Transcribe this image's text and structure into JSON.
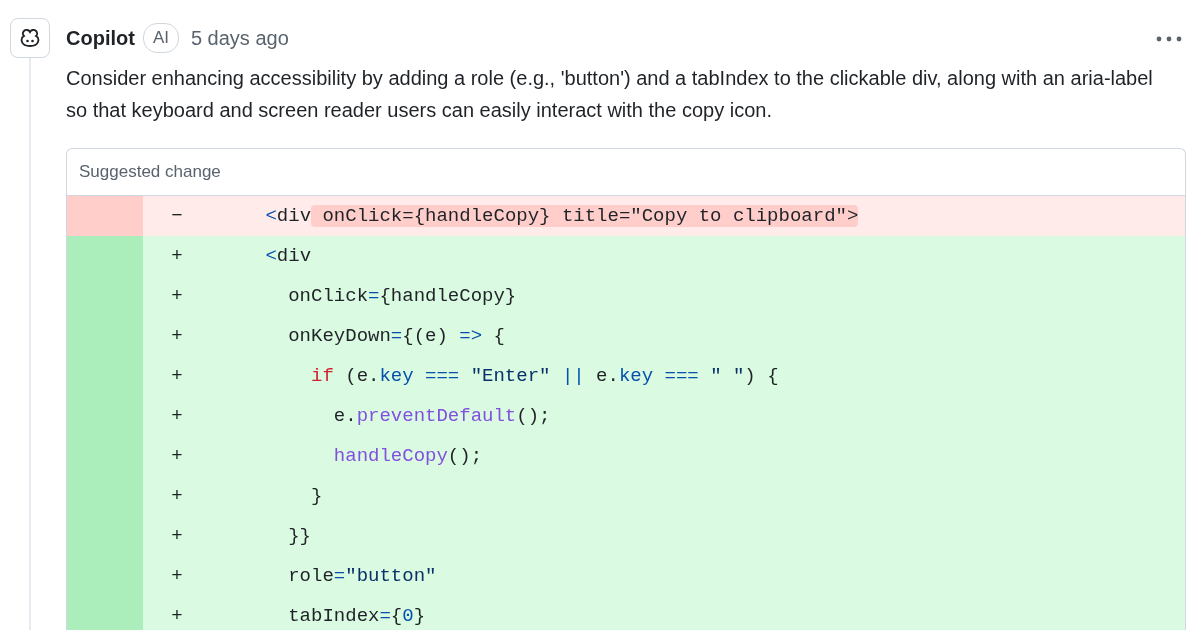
{
  "comment": {
    "author": "Copilot",
    "badge": "AI",
    "time": "5 days ago",
    "body": "Consider enhancing accessibility by adding a role (e.g., 'button') and a tabIndex to the clickable div, along with an aria-label so that keyboard and screen reader users can easily interact with the copy icon."
  },
  "suggestion": {
    "title": "Suggested change",
    "lines": [
      {
        "kind": "removed",
        "marker": "−",
        "tokens": [
          {
            "kind": "punct",
            "text": "      <"
          },
          {
            "kind": "plain",
            "text": "div"
          },
          {
            "kind": "changed",
            "text": " onClick={handleCopy} title=\"Copy to clipboard\">"
          }
        ]
      },
      {
        "kind": "added",
        "marker": "+",
        "tokens": [
          {
            "kind": "punct",
            "text": "      <"
          },
          {
            "kind": "plain",
            "text": "div"
          }
        ]
      },
      {
        "kind": "added",
        "marker": "+",
        "tokens": [
          {
            "kind": "plain",
            "text": "        onClick"
          },
          {
            "kind": "operator",
            "text": "="
          },
          {
            "kind": "plain",
            "text": "{handleCopy}"
          }
        ]
      },
      {
        "kind": "added",
        "marker": "+",
        "tokens": [
          {
            "kind": "plain",
            "text": "        onKeyDown"
          },
          {
            "kind": "operator",
            "text": "="
          },
          {
            "kind": "plain",
            "text": "{(e) "
          },
          {
            "kind": "operator",
            "text": "=>"
          },
          {
            "kind": "plain",
            "text": " {"
          }
        ]
      },
      {
        "kind": "added",
        "marker": "+",
        "tokens": [
          {
            "kind": "keyword",
            "text": "          if"
          },
          {
            "kind": "plain",
            "text": " (e."
          },
          {
            "kind": "property",
            "text": "key"
          },
          {
            "kind": "operator",
            "text": " ==="
          },
          {
            "kind": "string",
            "text": " \"Enter\""
          },
          {
            "kind": "operator",
            "text": " ||"
          },
          {
            "kind": "plain",
            "text": " e."
          },
          {
            "kind": "property",
            "text": "key"
          },
          {
            "kind": "operator",
            "text": " ==="
          },
          {
            "kind": "string",
            "text": " \" \""
          },
          {
            "kind": "plain",
            "text": ") {"
          }
        ]
      },
      {
        "kind": "added",
        "marker": "+",
        "tokens": [
          {
            "kind": "plain",
            "text": "            e."
          },
          {
            "kind": "function",
            "text": "preventDefault"
          },
          {
            "kind": "plain",
            "text": "();"
          }
        ]
      },
      {
        "kind": "added",
        "marker": "+",
        "tokens": [
          {
            "kind": "function",
            "text": "            handleCopy"
          },
          {
            "kind": "plain",
            "text": "();"
          }
        ]
      },
      {
        "kind": "added",
        "marker": "+",
        "tokens": [
          {
            "kind": "plain",
            "text": "          }"
          }
        ]
      },
      {
        "kind": "added",
        "marker": "+",
        "tokens": [
          {
            "kind": "plain",
            "text": "        }}"
          }
        ]
      },
      {
        "kind": "added",
        "marker": "+",
        "tokens": [
          {
            "kind": "plain",
            "text": "        role"
          },
          {
            "kind": "operator",
            "text": "="
          },
          {
            "kind": "string",
            "text": "\"button\""
          }
        ]
      },
      {
        "kind": "added",
        "marker": "+",
        "tokens": [
          {
            "kind": "plain",
            "text": "        tabIndex"
          },
          {
            "kind": "operator",
            "text": "="
          },
          {
            "kind": "plain",
            "text": "{"
          },
          {
            "kind": "property",
            "text": "0"
          },
          {
            "kind": "plain",
            "text": "}"
          }
        ]
      }
    ]
  }
}
